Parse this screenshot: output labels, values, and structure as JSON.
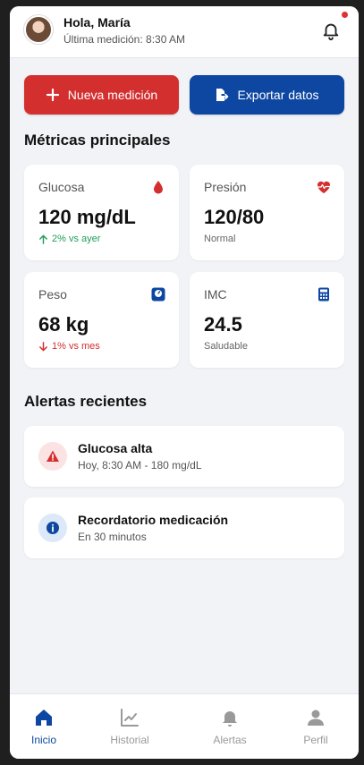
{
  "header": {
    "greeting": "Hola, María",
    "subtitle": "Última medición: 8:30 AM",
    "has_notifications": true
  },
  "actions": {
    "new_measurement": "Nueva medición",
    "export": "Exportar datos"
  },
  "metrics": {
    "title": "Métricas principales",
    "items": [
      {
        "label": "Glucosa",
        "value": "120 mg/dL",
        "note": "2% vs ayer",
        "trend": "up",
        "icon": "blood-drop-icon"
      },
      {
        "label": "Presión",
        "value": "120/80",
        "note": "Normal",
        "icon": "heartbeat-icon"
      },
      {
        "label": "Peso",
        "value": "68 kg",
        "note": "1% vs mes",
        "trend": "down",
        "icon": "scale-icon"
      },
      {
        "label": "IMC",
        "value": "24.5",
        "note": "Saludable",
        "icon": "calculator-icon"
      }
    ]
  },
  "alerts": {
    "title": "Alertas recientes",
    "items": [
      {
        "title": "Glucosa alta",
        "subtitle": "Hoy, 8:30 AM - 180 mg/dL",
        "icon": "warning-icon"
      },
      {
        "title": "Recordatorio medicación",
        "subtitle": "En 30 minutos",
        "icon": "info-icon"
      }
    ]
  },
  "nav": {
    "items": [
      {
        "label": "Inicio",
        "icon": "home-icon",
        "active": true
      },
      {
        "label": "Historial",
        "icon": "chart-icon"
      },
      {
        "label": "Alertas",
        "icon": "bell-icon"
      },
      {
        "label": "Perfil",
        "icon": "user-icon"
      }
    ]
  },
  "colors": {
    "primary_red": "#d32f2f",
    "primary_blue": "#0d47a1",
    "success_green": "#1e9e5a",
    "background": "#f1f3f7"
  }
}
